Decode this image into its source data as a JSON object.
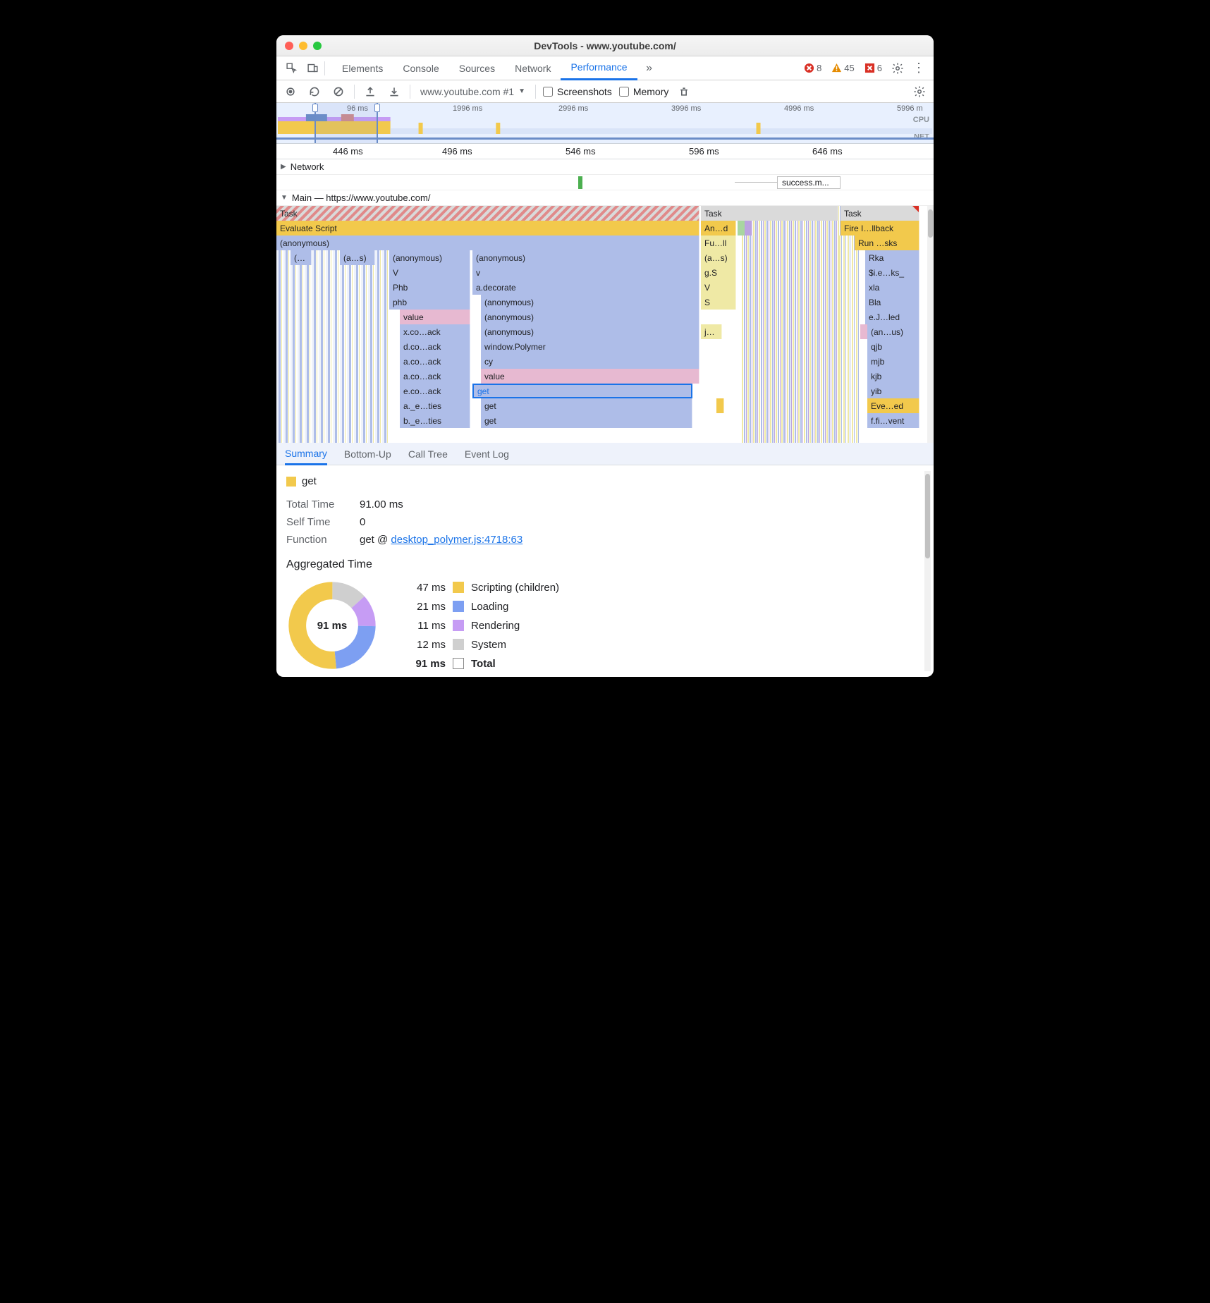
{
  "window": {
    "title": "DevTools - www.youtube.com/"
  },
  "top_tabs": {
    "elements": "Elements",
    "console": "Console",
    "sources": "Sources",
    "network": "Network",
    "performance": "Performance"
  },
  "issues": {
    "errors": "8",
    "warnings": "45",
    "blocked": "6"
  },
  "toolbar2": {
    "target": "www.youtube.com #1",
    "screenshots": "Screenshots",
    "memory": "Memory"
  },
  "overview": {
    "ticks": [
      "96 ms",
      "1996 ms",
      "2996 ms",
      "3996 ms",
      "4996 ms",
      "5996 m"
    ],
    "cpu": "CPU",
    "net": "NET"
  },
  "ruler": [
    "446 ms",
    "496 ms",
    "546 ms",
    "596 ms",
    "646 ms"
  ],
  "network_row": {
    "label": "Network",
    "success": "success.m..."
  },
  "main_row": {
    "label": "Main — https://www.youtube.com/"
  },
  "flame": {
    "col1": {
      "task": "Task",
      "eval": "Evaluate Script",
      "anon": "(anonymous)",
      "r3a": "(…",
      "r3b": "(a…s)",
      "r3c": "(anonymous)",
      "r3d": "(anonymous)",
      "r4a": "V",
      "r4b": "v",
      "r5a": "Phb",
      "r5b": "a.decorate",
      "r6a": "phb",
      "r6b": "(anonymous)",
      "r7a": "value",
      "r7b": "(anonymous)",
      "r8a": "x.co…ack",
      "r8b": "(anonymous)",
      "r9a": "d.co…ack",
      "r9b": "window.Polymer",
      "r10a": "a.co…ack",
      "r10b": "cy",
      "r11a": "a.co…ack",
      "r11b": "value",
      "r12a": "e.co…ack",
      "r12b": "get",
      "r13a": "a._e…ties",
      "r13b": "get",
      "r14a": "b._e…ties",
      "r14b": "get"
    },
    "col2": {
      "task": "Task",
      "and": "An…d",
      "full": "Fu…ll",
      "as": "(a…s)",
      "gs": "g.S",
      "v": "V",
      "s": "S",
      "j": "j…"
    },
    "col3": {
      "task": "Task",
      "fire": "Fire I…llback",
      "run": "Run …sks",
      "rka": "Rka",
      "ie": "$i.e…ks_",
      "xla": "xla",
      "bla": "Bla",
      "ej": "e.J…led",
      "anus": "(an…us)",
      "qjb": "qjb",
      "mjb": "mjb",
      "kjb": "kjb",
      "yib": "yib",
      "eve": "Eve…ed",
      "ffi": "f.fi…vent"
    }
  },
  "btabs": {
    "summary": "Summary",
    "bottom": "Bottom-Up",
    "call": "Call Tree",
    "event": "Event Log"
  },
  "summary": {
    "fn": "get",
    "total_k": "Total Time",
    "total_v": "91.00 ms",
    "self_k": "Self Time",
    "self_v": "0",
    "func_k": "Function",
    "func_pre": "get @ ",
    "func_link": "desktop_polymer.js:4718:63",
    "agg": "Aggregated Time",
    "center": "91 ms",
    "legend": [
      {
        "ms": "47 ms",
        "color": "#f2c94c",
        "label": "Scripting (children)"
      },
      {
        "ms": "21 ms",
        "color": "#7d9ff2",
        "label": "Loading"
      },
      {
        "ms": "11 ms",
        "color": "#c69cf4",
        "label": "Rendering"
      },
      {
        "ms": "12 ms",
        "color": "#cfcfcf",
        "label": "System"
      }
    ],
    "total_row": {
      "ms": "91 ms",
      "label": "Total"
    }
  },
  "chart_data": {
    "type": "pie",
    "title": "Aggregated Time",
    "series": [
      {
        "name": "get",
        "values": [
          47,
          21,
          11,
          12
        ]
      }
    ],
    "categories": [
      "Scripting (children)",
      "Loading",
      "Rendering",
      "System"
    ],
    "total": 91,
    "unit": "ms"
  }
}
